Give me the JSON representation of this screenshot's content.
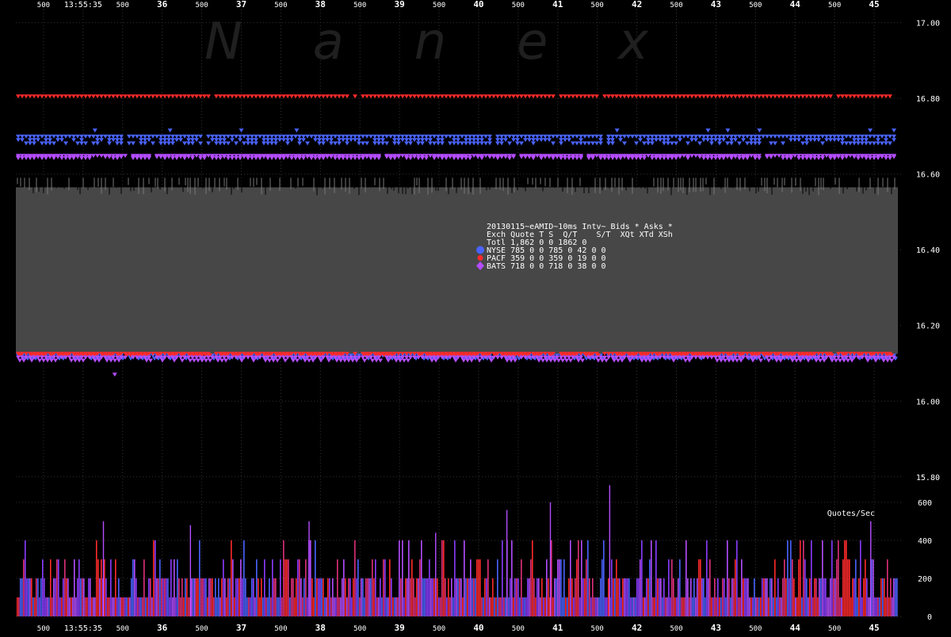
{
  "watermark": "Nanex",
  "colors": {
    "background": "#000000",
    "grid": "#333333",
    "band": "#474747",
    "nyse": "#4a63ff",
    "pacf": "#ff2a2a",
    "bats": "#b44dff",
    "text": "#ffffff"
  },
  "chart_data": {
    "type": "scatter",
    "x_ticks": [
      {
        "label": "500",
        "kind": "minor",
        "t": 34.5
      },
      {
        "label": "13:55:35",
        "kind": "time",
        "t": 35
      },
      {
        "label": "500",
        "kind": "minor",
        "t": 35.5
      },
      {
        "label": "36",
        "kind": "major",
        "t": 36
      },
      {
        "label": "500",
        "kind": "minor",
        "t": 36.5
      },
      {
        "label": "37",
        "kind": "major",
        "t": 37
      },
      {
        "label": "500",
        "kind": "minor",
        "t": 37.5
      },
      {
        "label": "38",
        "kind": "major",
        "t": 38
      },
      {
        "label": "500",
        "kind": "minor",
        "t": 38.5
      },
      {
        "label": "39",
        "kind": "major",
        "t": 39
      },
      {
        "label": "500",
        "kind": "minor",
        "t": 39.5
      },
      {
        "label": "40",
        "kind": "major",
        "t": 40
      },
      {
        "label": "500",
        "kind": "minor",
        "t": 40.5
      },
      {
        "label": "41",
        "kind": "major",
        "t": 41
      },
      {
        "label": "500",
        "kind": "minor",
        "t": 41.5
      },
      {
        "label": "42",
        "kind": "major",
        "t": 42
      },
      {
        "label": "500",
        "kind": "minor",
        "t": 42.5
      },
      {
        "label": "43",
        "kind": "major",
        "t": 43
      },
      {
        "label": "500",
        "kind": "minor",
        "t": 43.5
      },
      {
        "label": "44",
        "kind": "major",
        "t": 44
      },
      {
        "label": "500",
        "kind": "minor",
        "t": 44.5
      },
      {
        "label": "45",
        "kind": "major",
        "t": 45
      }
    ],
    "x_range": [
      34.15,
      45.3
    ],
    "price_ticks": [
      "17.00",
      "16.80",
      "16.60",
      "16.40",
      "16.20",
      "16.00",
      "15.80"
    ],
    "price_range": [
      15.72,
      17.06
    ],
    "rate_ticks": [
      "600",
      "400",
      "200",
      "0"
    ],
    "rate_label": "Quotes/Sec",
    "rate_range": [
      0,
      700
    ],
    "bid_band": [
      16.125,
      16.565
    ],
    "series": [
      {
        "name": "NYSE",
        "ask_price": 16.69,
        "bid_price": 16.12,
        "ask_spread": 0.018,
        "bid_spread": 0.008
      },
      {
        "name": "PACF",
        "ask_price": 16.805,
        "bid_price": 16.125,
        "ask_spread": 0.0,
        "bid_spread": 0.004
      },
      {
        "name": "BATS",
        "ask_price": 16.645,
        "bid_price": 16.115,
        "ask_spread": 0.006,
        "bid_spread": 0.008
      }
    ],
    "rate_peaks": [
      {
        "t": 35.25,
        "v": 500
      },
      {
        "t": 36.35,
        "v": 480
      },
      {
        "t": 37.85,
        "v": 500
      },
      {
        "t": 39.45,
        "v": 440
      },
      {
        "t": 40.35,
        "v": 560
      },
      {
        "t": 40.9,
        "v": 600
      },
      {
        "t": 41.65,
        "v": 690
      },
      {
        "t": 44.95,
        "v": 500
      }
    ]
  },
  "legend": {
    "title": "20130115~eAMID~10ms Intv~ Bids * Asks *",
    "header": "Exch Quote T S  Q/T    S/T  XQt XTd XSh",
    "rows": [
      {
        "text": "Totl 1,862 0 0  1862      0",
        "marker": ""
      },
      {
        "text": "NYSE   785 0 0   785      0  42   0   0",
        "marker": "nyse"
      },
      {
        "text": "PACF   359 0 0   359      0  19   0   0",
        "marker": "pacf"
      },
      {
        "text": "BATS   718 0 0   718      0  38   0   0",
        "marker": "bats"
      }
    ]
  }
}
